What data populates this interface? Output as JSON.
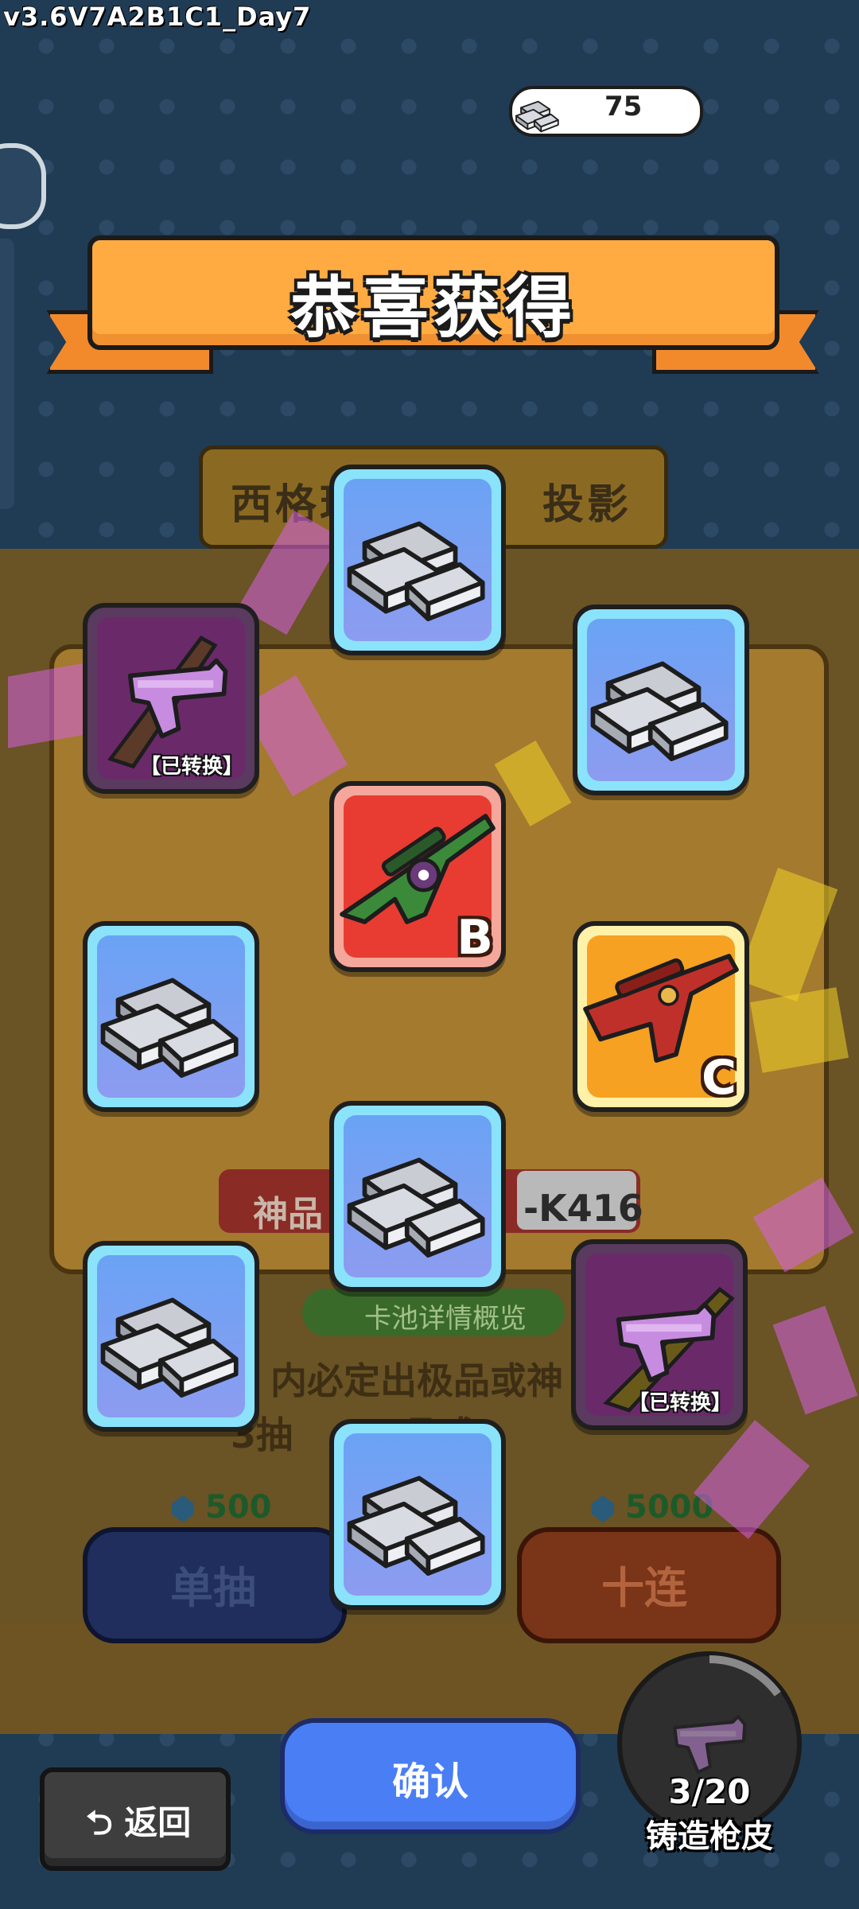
{
  "version": "v3.6V7A2B1C1_Day7",
  "currency": {
    "icon": "silver-ingot-icon",
    "value": "75"
  },
  "banner": {
    "title": "恭喜获得"
  },
  "background": {
    "pool_title": "西格玛　　　　投影",
    "prize_label": "神品",
    "prize_name": "-K416",
    "pool_details": "卡池详情概览",
    "info_line1": "内必定出极品或神",
    "info_line2": "3抽　　　品或",
    "single": {
      "label": "单抽",
      "cost": "500"
    },
    "ten": {
      "label": "十连",
      "cost": "5000"
    }
  },
  "rewards": [
    {
      "type": "silver-ingot",
      "icon": "silver-ingot-icon"
    },
    {
      "type": "pistol-skin",
      "icon": "purple-pistol-icon",
      "tag": "【已转换】"
    },
    {
      "type": "silver-ingot",
      "icon": "silver-ingot-icon"
    },
    {
      "type": "rifle-skin",
      "icon": "green-rifle-icon",
      "grade": "B"
    },
    {
      "type": "silver-ingot",
      "icon": "silver-ingot-icon"
    },
    {
      "type": "rifle-skin",
      "icon": "red-rifle-icon",
      "grade": "C"
    },
    {
      "type": "silver-ingot",
      "icon": "silver-ingot-icon"
    },
    {
      "type": "silver-ingot",
      "icon": "silver-ingot-icon"
    },
    {
      "type": "pistol-skin",
      "icon": "purple-pistol-icon",
      "tag": "【已转换】"
    },
    {
      "type": "silver-ingot",
      "icon": "silver-ingot-icon"
    }
  ],
  "buttons": {
    "back": "返回",
    "confirm": "确认"
  },
  "forge": {
    "progress": "3/20",
    "progress_fraction": 0.15,
    "label": "铸造枪皮"
  },
  "colors": {
    "banner": "#ffab42",
    "confirm": "#4a7ef5",
    "rare_glow": "#d660e6",
    "legend_glow": "#f0d228"
  }
}
